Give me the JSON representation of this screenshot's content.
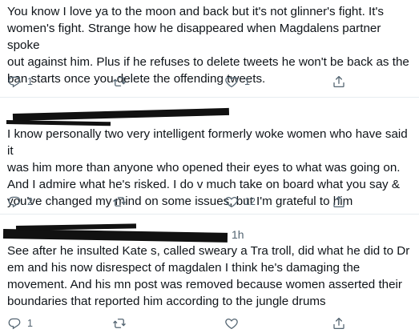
{
  "tweets": [
    {
      "lines": [
        "You know I love ya to the moon and back but it's not glinner's fight. It's",
        "women's fight. Strange how he disappeared when Magdalens partner spoke",
        "out against him. Plus if he refuses to delete tweets he won't be back as the",
        "ban starts once you delete the offending tweets."
      ],
      "reply_count": "1",
      "retweet_count": "",
      "like_count": "1"
    },
    {
      "lines": [
        "I know personally two very intelligent formerly woke women who have said it",
        "was him more than anyone who opened their eyes to what was going on.",
        "And I admire what he's risked. I do v much take on board what you say &",
        "you've changed my mind on some issues, but I'm grateful to him"
      ],
      "reply_count": "2",
      "retweet_count": "",
      "like_count": "12"
    },
    {
      "time": "1h",
      "lines": [
        "See after he insulted Kate s, called sweary a Tra troll, did what he did to Dr",
        "em and his now disrespect of magdalen I think he's damaging the",
        "movement. And his mn post was removed because women asserted their",
        "boundaries that reported him according to the jungle drums"
      ],
      "reply_count": "1",
      "retweet_count": "",
      "like_count": ""
    }
  ],
  "icons": {
    "reply": "reply-icon",
    "retweet": "retweet-icon",
    "like": "heart-icon",
    "share": "share-icon"
  },
  "colors": {
    "text": "#0f1419",
    "muted": "#536471",
    "divider": "#e6ecf0",
    "redaction": "#111111"
  }
}
